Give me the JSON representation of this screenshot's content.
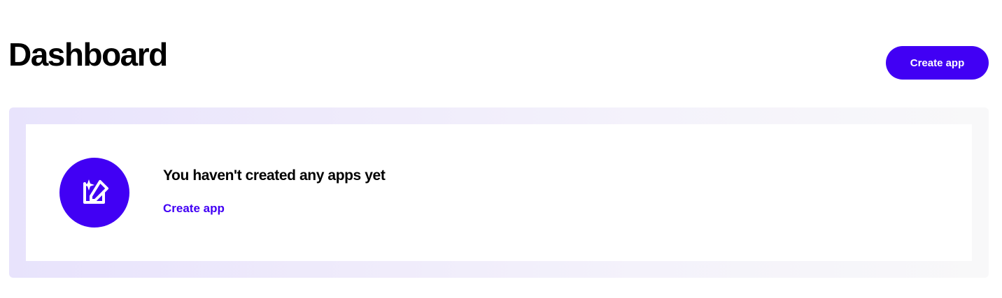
{
  "header": {
    "title": "Dashboard",
    "create_button_label": "Create app"
  },
  "empty_state": {
    "icon": "edit-sparkle-icon",
    "heading": "You haven't created any apps yet",
    "link_label": "Create app"
  },
  "colors": {
    "accent": "#4100f4",
    "panel_gradient_start": "#e8e3fc",
    "panel_gradient_end": "#f8f8f9",
    "text": "#000000",
    "background": "#ffffff"
  }
}
